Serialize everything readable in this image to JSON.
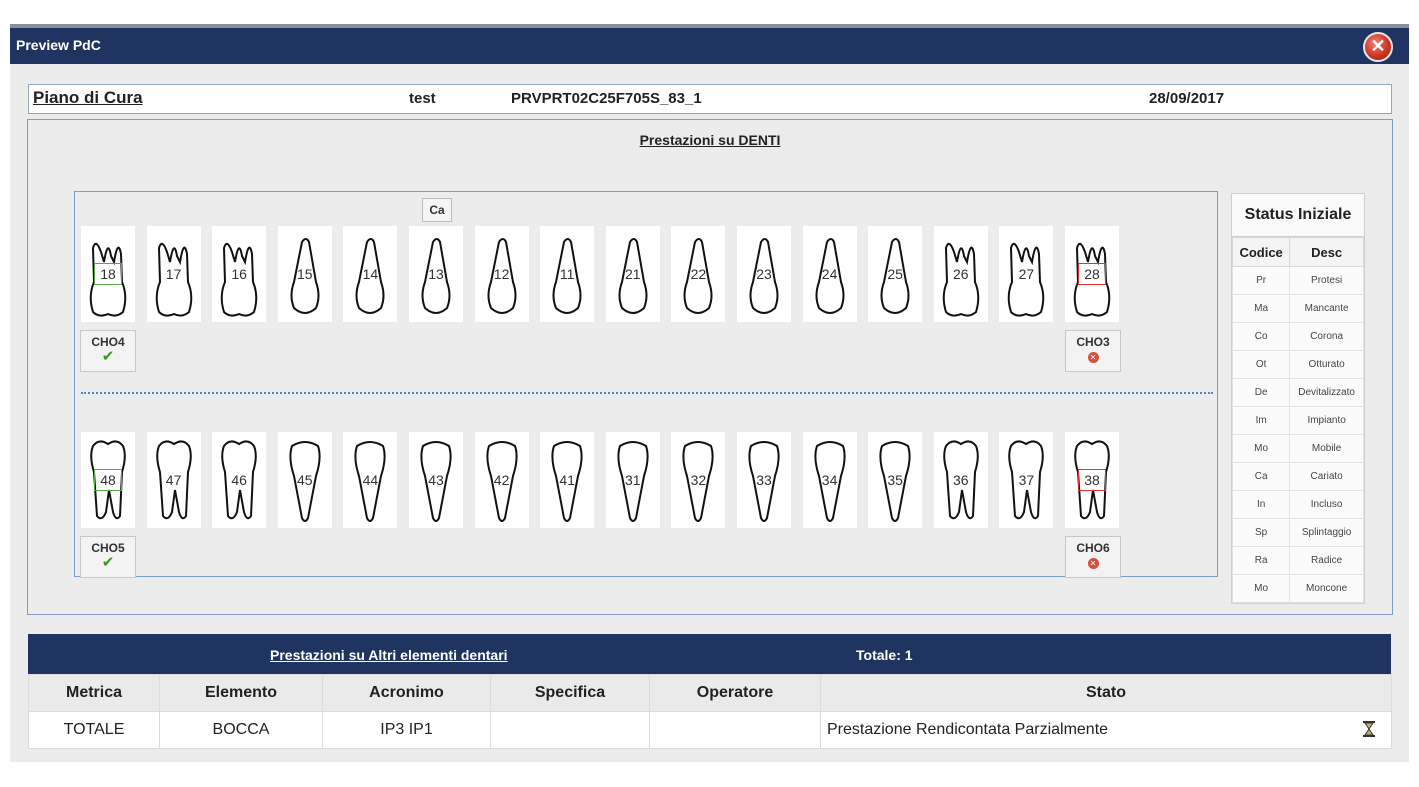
{
  "window": {
    "title": "Preview PdC",
    "close_label": "✕"
  },
  "pdc": {
    "title": "Piano di Cura",
    "name": "test",
    "code": "PRVPRT02C25F705S_83_1",
    "date": "28/09/2017"
  },
  "teeth_section": {
    "title": "Prestazioni su DENTI"
  },
  "upper_teeth": [
    "18",
    "17",
    "16",
    "15",
    "14",
    "13",
    "12",
    "11",
    "21",
    "22",
    "23",
    "24",
    "25",
    "26",
    "27",
    "28"
  ],
  "lower_teeth": [
    "48",
    "47",
    "46",
    "45",
    "44",
    "43",
    "42",
    "41",
    "31",
    "32",
    "33",
    "34",
    "35",
    "36",
    "37",
    "38"
  ],
  "ca_badge": {
    "label": "Ca",
    "tooth": "13"
  },
  "cho": [
    {
      "label": "CHO4",
      "status": "ok"
    },
    {
      "label": "CHO3",
      "status": "ko"
    },
    {
      "label": "CHO5",
      "status": "ok"
    },
    {
      "label": "CHO6",
      "status": "ko"
    }
  ],
  "status_panel": {
    "title": "Status Iniziale",
    "col_code": "Codice",
    "col_desc": "Desc",
    "rows": [
      [
        "Pr",
        "Protesi"
      ],
      [
        "Ma",
        "Mancante"
      ],
      [
        "Co",
        "Corona"
      ],
      [
        "Ot",
        "Otturato"
      ],
      [
        "De",
        "Devitalizzato"
      ],
      [
        "Im",
        "Impianto"
      ],
      [
        "Mo",
        "Mobile"
      ],
      [
        "Ca",
        "Cariato"
      ],
      [
        "In",
        "Incluso"
      ],
      [
        "Sp",
        "Splintaggio"
      ],
      [
        "Ra",
        "Radice"
      ],
      [
        "Mo",
        "Moncone"
      ]
    ]
  },
  "others": {
    "title": "Prestazioni su Altri elementi dentari",
    "total": "Totale: 1",
    "headers": [
      "Metrica",
      "Elemento",
      "Acronimo",
      "Specifica",
      "Operatore",
      "Stato"
    ],
    "rows": [
      {
        "metrica": "TOTALE",
        "elemento": "BOCCA",
        "acronimo": "IP3 IP1",
        "specifica": "",
        "operatore": "",
        "stato": "Prestazione Rendicontata Parzialmente"
      }
    ]
  },
  "colors": {
    "header_bar": "#1f3460",
    "ok": "#3a9a20",
    "ko": "#d94c3a"
  }
}
